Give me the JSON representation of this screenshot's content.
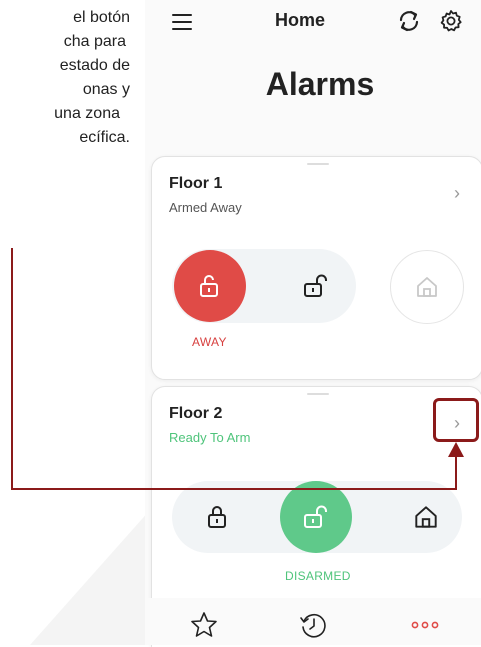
{
  "annotation": {
    "lines": [
      "el botón",
      "cha para",
      "estado de",
      "onas y",
      "una zona",
      "ecífica."
    ]
  },
  "header": {
    "title": "Home",
    "menu_icon": "hamburger-menu-icon",
    "refresh_icon": "refresh-icon",
    "settings_icon": "gear-icon"
  },
  "page": {
    "title": "Alarms"
  },
  "zones": [
    {
      "name": "Floor 1",
      "status": "Armed Away",
      "status_color": "#555555",
      "state_label": "AWAY",
      "state_color": "#d7403f"
    },
    {
      "name": "Floor 2",
      "status": "Ready To Arm",
      "status_color": "#4fc47b",
      "state_label": "DISARMED",
      "state_color": "#4fc47b"
    }
  ],
  "colors": {
    "away_red": "#e04b47",
    "disarmed_green": "#5fc98a",
    "annotation": "#8b1a1a"
  },
  "bottom_nav": [
    "star-icon",
    "history-icon",
    "more-dots-icon"
  ]
}
